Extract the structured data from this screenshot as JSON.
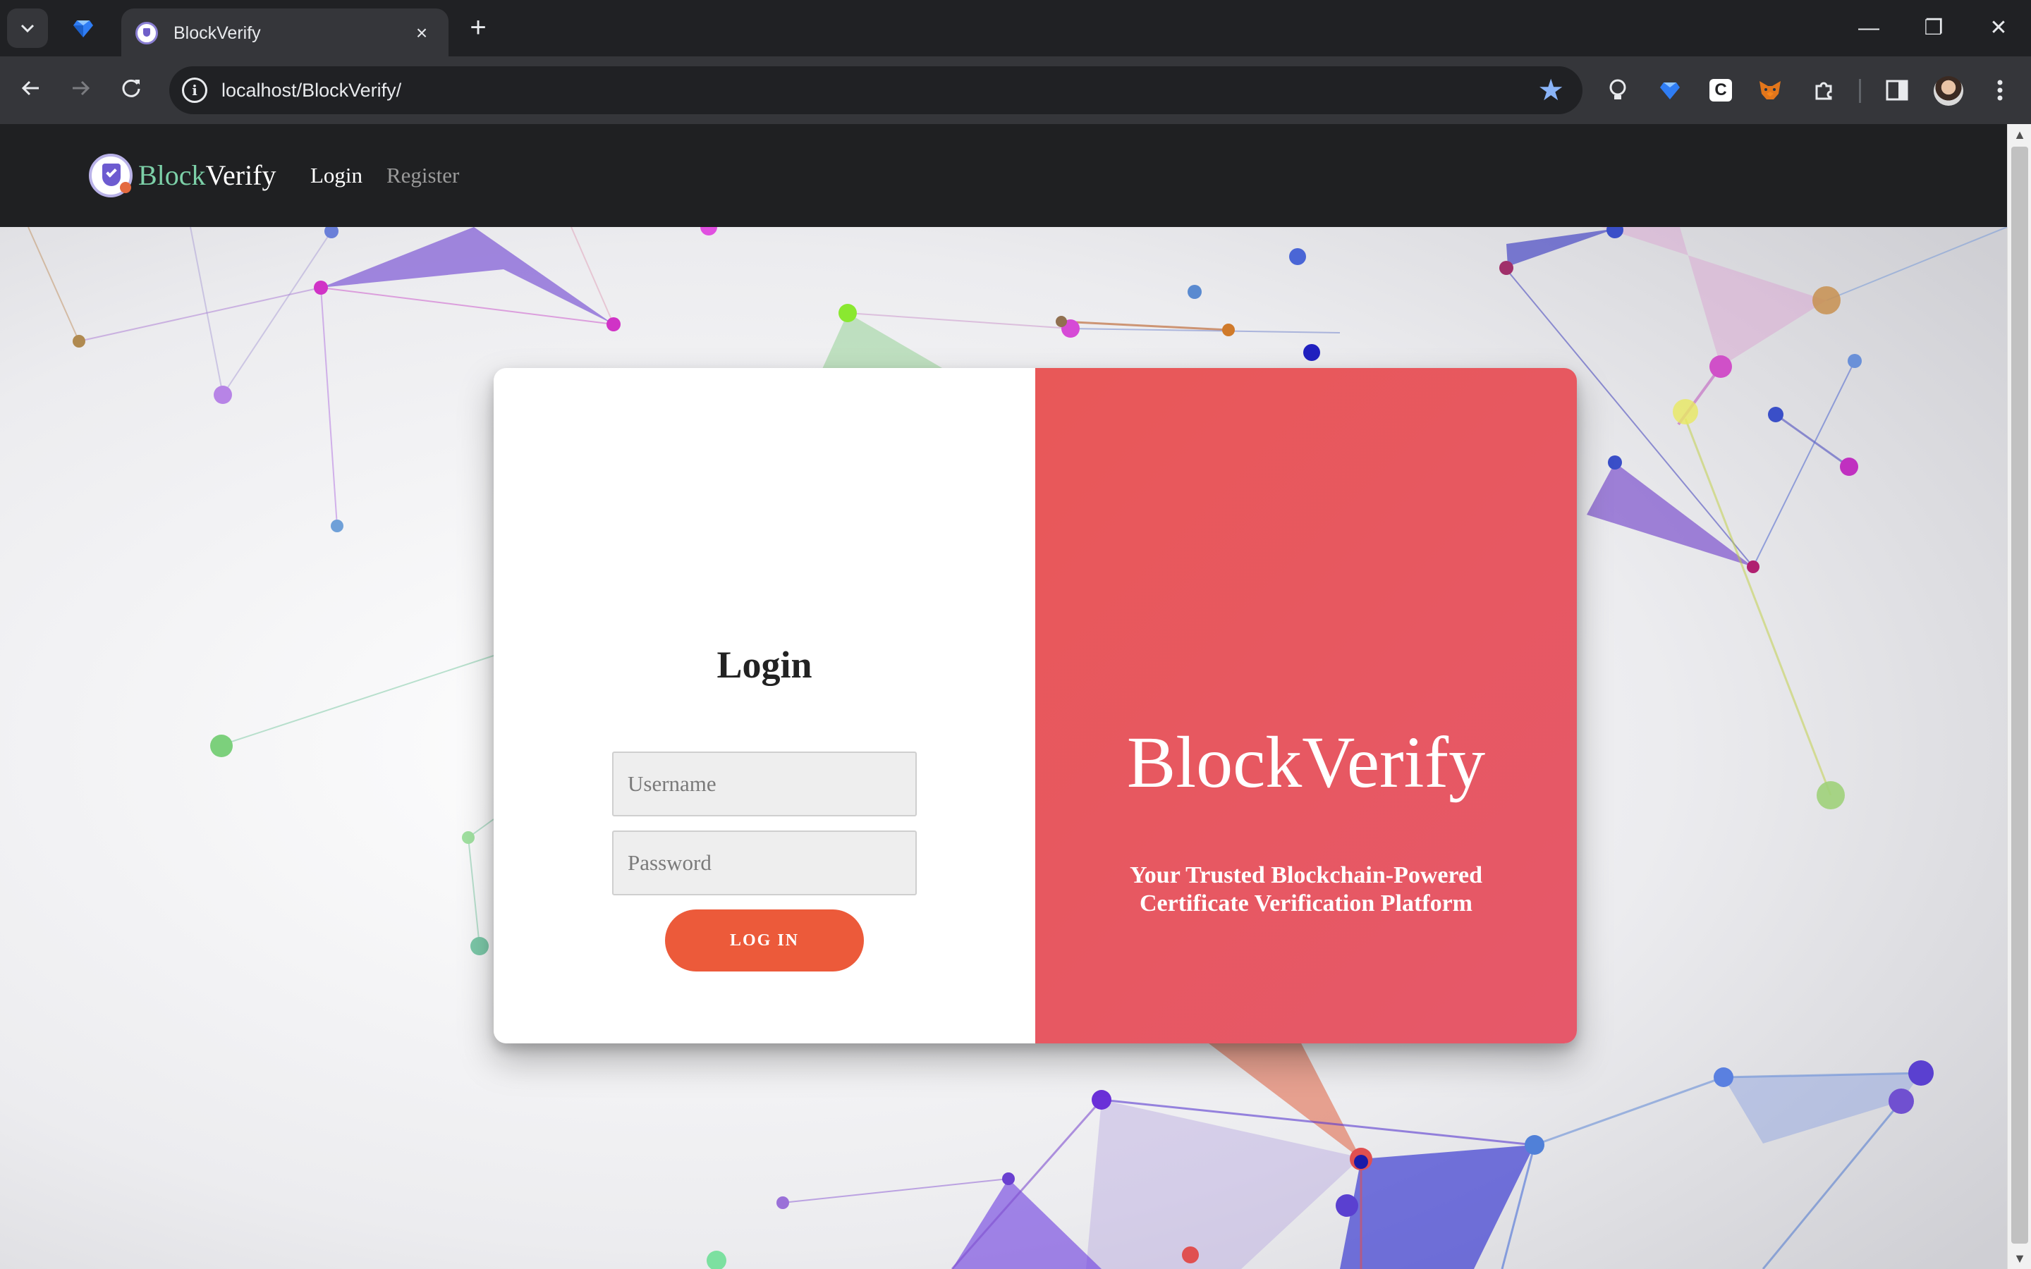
{
  "browser": {
    "tab_title": "BlockVerify",
    "url": "localhost/BlockVerify/",
    "tab_close_icon": "×",
    "new_tab_icon": "+",
    "window_controls": {
      "minimize": "—",
      "restore": "❐",
      "close": "✕"
    }
  },
  "site": {
    "brand_part1": "Block",
    "brand_part2": "Verify",
    "nav": {
      "login": "Login",
      "register": "Register"
    },
    "nav_colors": {
      "active": "#ffffff",
      "inactive": "#9a9a9a",
      "brand_accent": "#7cd0a8"
    }
  },
  "login_form": {
    "heading": "Login",
    "username_placeholder": "Username",
    "password_placeholder": "Password",
    "submit_label": "LOG IN",
    "button_color": "#ec5a3a"
  },
  "hero": {
    "title": "BlockVerify",
    "subtitle_line1": "Your Trusted Blockchain-Powered",
    "subtitle_line2": "Certificate Verification Platform",
    "panel_color": "#e6586a"
  }
}
